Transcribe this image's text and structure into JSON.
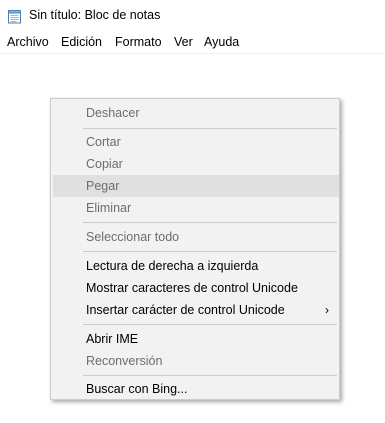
{
  "window": {
    "title": "Sin título: Bloc de notas",
    "icon": "notepad-icon"
  },
  "menubar": {
    "items": [
      "Archivo",
      "Edición",
      "Formato",
      "Ver",
      "Ayuda"
    ]
  },
  "context_menu": {
    "items": [
      {
        "label": "Deshacer",
        "enabled": false
      },
      {
        "label": "Cortar",
        "enabled": false
      },
      {
        "label": "Copiar",
        "enabled": false
      },
      {
        "label": "Pegar",
        "enabled": false,
        "highlighted": true
      },
      {
        "label": "Eliminar",
        "enabled": false
      },
      {
        "label": "Seleccionar todo",
        "enabled": false
      },
      {
        "label": "Lectura de derecha a izquierda",
        "enabled": true
      },
      {
        "label": "Mostrar caracteres de control Unicode",
        "enabled": true
      },
      {
        "label": "Insertar carácter de control Unicode",
        "enabled": true,
        "submenu": true,
        "submenu_glyph": "›"
      },
      {
        "label": "Abrir IME",
        "enabled": true
      },
      {
        "label": "Reconversión",
        "enabled": false
      },
      {
        "label": "Buscar con Bing...",
        "enabled": true
      }
    ]
  },
  "colors": {
    "menu_background": "#f2f2f2",
    "highlight": "#e0e0e0",
    "disabled_text": "#6d6d6d",
    "separator": "#cccccc"
  }
}
